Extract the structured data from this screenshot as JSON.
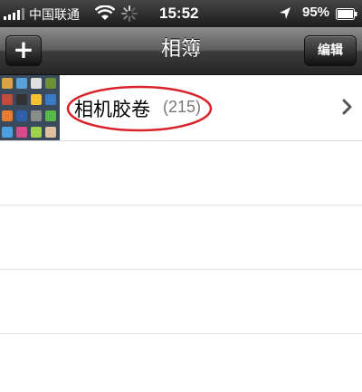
{
  "status_bar": {
    "carrier": "中国联通",
    "time": "15:52",
    "battery_percent": "95%"
  },
  "nav_bar": {
    "add_label": "+",
    "title": "相簿",
    "edit_label": "编辑"
  },
  "albums": [
    {
      "name": "相机胶卷",
      "count": "(215)"
    }
  ],
  "colors": {
    "nav_bar": "#3b3b3b",
    "annotation_circle": "#d9232b",
    "separator": "#e2e2e2"
  },
  "icons": [
    "signal-bars-icon",
    "wifi-icon",
    "activity-spinner-icon",
    "location-arrow-icon",
    "battery-icon",
    "chevron-right-icon"
  ]
}
